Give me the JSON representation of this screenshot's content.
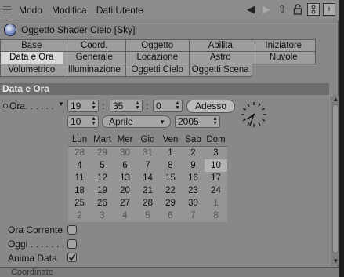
{
  "menubar": {
    "items": [
      "Modo",
      "Modifica",
      "Dati Utente"
    ]
  },
  "toolbar_icons": [
    "back-arrow-icon",
    "forward-arrow-icon",
    "up-arrow-icon",
    "lock-icon",
    "settings-icon",
    "new-window-icon"
  ],
  "title": "Oggetto Shader Cielo [Sky]",
  "tabs": [
    [
      "Base",
      "Coord.",
      "Oggetto",
      "Abilita",
      "Iniziatore"
    ],
    [
      "Data e Ora",
      "Generale",
      "Locazione",
      "Astro",
      "Nuvole"
    ],
    [
      "Volumetrico",
      "Illuminazione",
      "Oggetti Cielo",
      "Oggetti Scena"
    ]
  ],
  "active_tab": "Data e Ora",
  "section_title": "Data e Ora",
  "ora": {
    "label": "Ora",
    "dots": " . . . . . .",
    "hour": "19",
    "minute": "35",
    "second": "0",
    "now_button": "Adesso",
    "day": "10",
    "month": "Aprile",
    "year": "2005"
  },
  "calendar": {
    "weekdays": [
      "Lun",
      "Mart",
      "Mer",
      "Gio",
      "Ven",
      "Sab",
      "Dom"
    ],
    "weeks": [
      [
        "28",
        "29",
        "30",
        "31",
        "1",
        "2",
        "3"
      ],
      [
        "4",
        "5",
        "6",
        "7",
        "8",
        "9",
        "10"
      ],
      [
        "11",
        "12",
        "13",
        "14",
        "15",
        "16",
        "17"
      ],
      [
        "18",
        "19",
        "20",
        "21",
        "22",
        "23",
        "24"
      ],
      [
        "25",
        "26",
        "27",
        "28",
        "29",
        "30",
        "1"
      ],
      [
        "2",
        "3",
        "4",
        "5",
        "6",
        "7",
        "8"
      ]
    ],
    "selected": "10"
  },
  "options": [
    {
      "label": "Ora Corrente",
      "checked": false
    },
    {
      "label": "Oggi . . . . . . .",
      "checked": false
    },
    {
      "label": "Anima Data",
      "checked": true
    }
  ],
  "bottom_label": "Coordinate",
  "colors": {
    "panel_bg": "#888888",
    "section_header": "#6c6c6c",
    "active_tab": "#d8d8d8"
  }
}
